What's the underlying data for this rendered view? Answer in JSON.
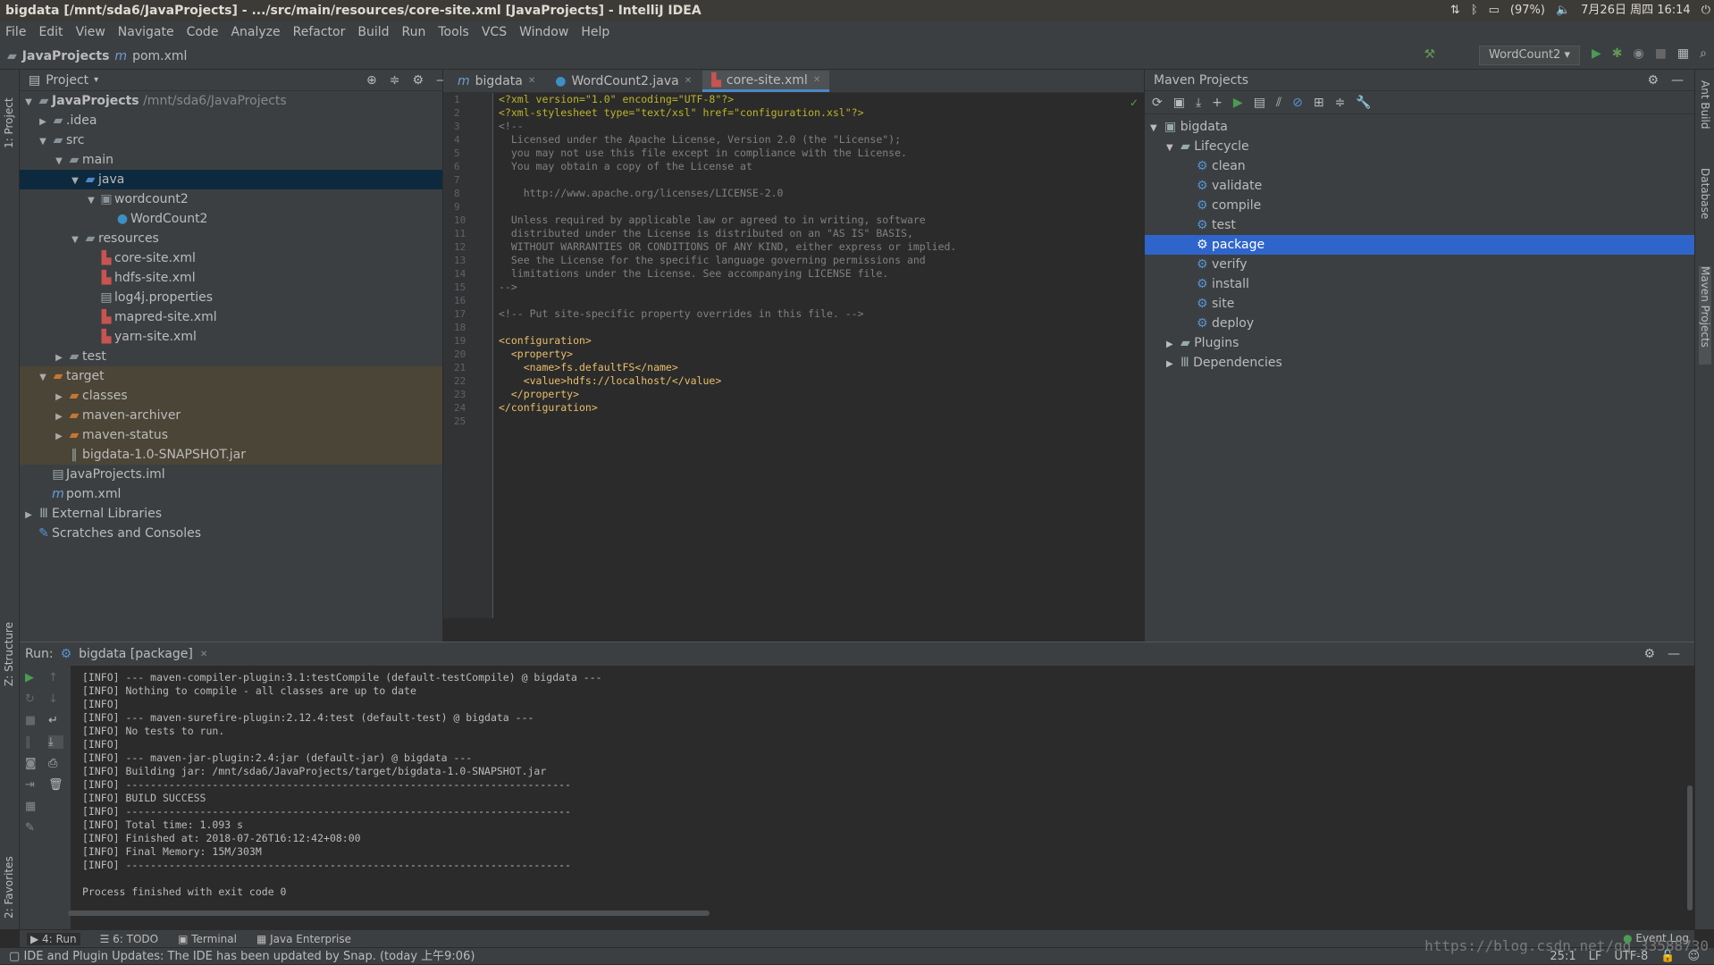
{
  "window": {
    "title": "bigdata [/mnt/sda6/JavaProjects] - .../src/main/resources/core-site.xml [JavaProjects] - IntelliJ IDEA"
  },
  "system": {
    "battery": "(97%)",
    "datetime": "7月26日 周四 16:14"
  },
  "menu": [
    "File",
    "Edit",
    "View",
    "Navigate",
    "Code",
    "Analyze",
    "Refactor",
    "Build",
    "Run",
    "Tools",
    "VCS",
    "Window",
    "Help"
  ],
  "nav": {
    "project": "JavaProjects",
    "file": "pom.xml",
    "run_config": "WordCount2"
  },
  "left_strip": {
    "project": "1: Project",
    "structure": "Z: Structure",
    "favorites": "2: Favorites"
  },
  "right_strip": {
    "ant": "Ant Build",
    "database": "Database",
    "maven": "Maven Projects"
  },
  "project_panel": {
    "title": "Project",
    "root_name": "JavaProjects",
    "root_path": "/mnt/sda6/JavaProjects",
    "items": [
      ".idea",
      "src",
      "main",
      "java",
      "wordcount2",
      "WordCount2",
      "resources",
      "core-site.xml",
      "hdfs-site.xml",
      "log4j.properties",
      "mapred-site.xml",
      "yarn-site.xml",
      "test",
      "target",
      "classes",
      "maven-archiver",
      "maven-status",
      "bigdata-1.0-SNAPSHOT.jar",
      "JavaProjects.iml",
      "pom.xml",
      "External Libraries",
      "Scratches and Consoles"
    ]
  },
  "editor": {
    "tabs": [
      "bigdata",
      "WordCount2.java",
      "core-site.xml"
    ],
    "line_numbers": [
      "1",
      "2",
      "3",
      "4",
      "5",
      "6",
      "7",
      "8",
      "9",
      "10",
      "11",
      "12",
      "13",
      "14",
      "15",
      "16",
      "17",
      "18",
      "19",
      "20",
      "21",
      "22",
      "23",
      "24",
      "25"
    ],
    "lines": [
      "<?xml version=\"1.0\" encoding=\"UTF-8\"?>",
      "<?xml-stylesheet type=\"text/xsl\" href=\"configuration.xsl\"?>",
      "<!--",
      "  Licensed under the Apache License, Version 2.0 (the \"License\");",
      "  you may not use this file except in compliance with the License.",
      "  You may obtain a copy of the License at",
      "",
      "    http://www.apache.org/licenses/LICENSE-2.0",
      "",
      "  Unless required by applicable law or agreed to in writing, software",
      "  distributed under the License is distributed on an \"AS IS\" BASIS,",
      "  WITHOUT WARRANTIES OR CONDITIONS OF ANY KIND, either express or implied.",
      "  See the License for the specific language governing permissions and",
      "  limitations under the License. See accompanying LICENSE file.",
      "-->",
      "",
      "<!-- Put site-specific property overrides in this file. -->",
      "",
      "<configuration>",
      "  <property>",
      "    <name>fs.defaultFS</name>",
      "    <value>hdfs://localhost/</value>",
      "  </property>",
      "</configuration>",
      ""
    ]
  },
  "maven": {
    "title": "Maven Projects",
    "root": "bigdata",
    "lifecycle": "Lifecycle",
    "goals": [
      "clean",
      "validate",
      "compile",
      "test",
      "package",
      "verify",
      "install",
      "site",
      "deploy"
    ],
    "plugins": "Plugins",
    "dependencies": "Dependencies"
  },
  "run": {
    "label": "Run:",
    "tab": "bigdata [package]",
    "output": [
      "[INFO] --- maven-compiler-plugin:3.1:testCompile (default-testCompile) @ bigdata ---",
      "[INFO] Nothing to compile - all classes are up to date",
      "[INFO]",
      "[INFO] --- maven-surefire-plugin:2.12.4:test (default-test) @ bigdata ---",
      "[INFO] No tests to run.",
      "[INFO]",
      "[INFO] --- maven-jar-plugin:2.4:jar (default-jar) @ bigdata ---",
      "[INFO] Building jar: /mnt/sda6/JavaProjects/target/bigdata-1.0-SNAPSHOT.jar",
      "[INFO] ------------------------------------------------------------------------",
      "[INFO] BUILD SUCCESS",
      "[INFO] ------------------------------------------------------------------------",
      "[INFO] Total time: 1.093 s",
      "[INFO] Finished at: 2018-07-26T16:12:42+08:00",
      "[INFO] Final Memory: 15M/303M",
      "[INFO] ------------------------------------------------------------------------",
      "",
      "Process finished with exit code 0"
    ]
  },
  "bottom_tabs": [
    "4: Run",
    "6: TODO",
    "Terminal",
    "Java Enterprise"
  ],
  "event_log": "Event Log",
  "status": {
    "message": "IDE and Plugin Updates: The IDE has been updated by Snap. (today 上午9:06)",
    "position": "25:1",
    "line_sep": "LF",
    "encoding": "UTF-8",
    "watermark": "https://blog.csdn.net/qq_33588730"
  }
}
